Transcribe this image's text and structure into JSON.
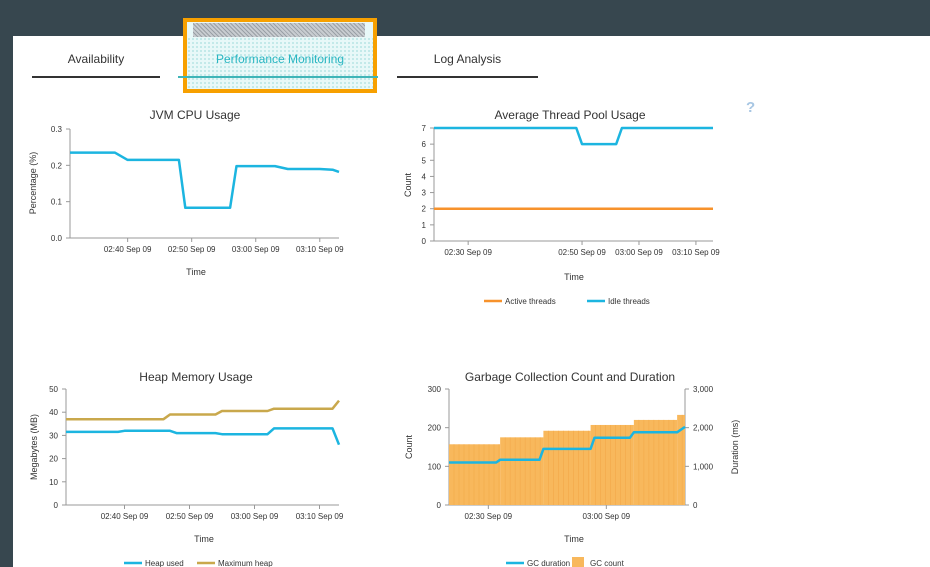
{
  "tabs": [
    {
      "label": "Availability",
      "active": false
    },
    {
      "label": "Performance Monitoring",
      "active": true
    },
    {
      "label": "Log Analysis",
      "active": false
    }
  ],
  "help": "?",
  "colors": {
    "cyan": "#1cb5e0",
    "orange": "#f7922b",
    "gold": "#c9a84c",
    "bar": "#f8b85c",
    "highlight": "#f7a000"
  },
  "chart_data": [
    {
      "type": "line",
      "title": "JVM CPU Usage",
      "xlabel": "Time",
      "ylabel": "Percentage (%)",
      "yticks": [
        "0.0",
        "0.1",
        "0.2",
        "0.3"
      ],
      "ylim": [
        0,
        0.3
      ],
      "xticks": [
        "02:40 Sep 09",
        "02:50 Sep 09",
        "03:00 Sep 09",
        "03:10 Sep 09"
      ],
      "xlim": [
        "02:31",
        "03:13"
      ],
      "series": [
        {
          "color": "#1cb5e0",
          "x": [
            "02:31",
            "02:38",
            "02:40",
            "02:48",
            "02:49",
            "02:56",
            "02:57",
            "03:03",
            "03:05",
            "03:10",
            "03:12",
            "03:13"
          ],
          "y": [
            0.235,
            0.235,
            0.215,
            0.215,
            0.083,
            0.083,
            0.198,
            0.198,
            0.19,
            0.19,
            0.188,
            0.182
          ]
        }
      ]
    },
    {
      "type": "line",
      "title": "Average Thread Pool Usage",
      "xlabel": "Time",
      "ylabel": "Count",
      "yticks": [
        "0",
        "1",
        "2",
        "3",
        "4",
        "5",
        "6",
        "7"
      ],
      "ylim": [
        0,
        7
      ],
      "xticks": [
        "02:30 Sep 09",
        "02:50 Sep 09",
        "03:00 Sep 09",
        "03:10 Sep 09"
      ],
      "xlim": [
        "02:24",
        "03:13"
      ],
      "legend": [
        {
          "name": "Active threads",
          "color": "#f7922b"
        },
        {
          "name": "Idle threads",
          "color": "#1cb5e0"
        }
      ],
      "series": [
        {
          "name": "Active threads",
          "color": "#f7922b",
          "x": [
            "02:24",
            "03:13"
          ],
          "y": [
            2,
            2
          ]
        },
        {
          "name": "Idle threads",
          "color": "#1cb5e0",
          "x": [
            "02:24",
            "02:49",
            "02:50",
            "02:56",
            "02:57",
            "03:13"
          ],
          "y": [
            7,
            7,
            6,
            6,
            7,
            7
          ]
        }
      ]
    },
    {
      "type": "line",
      "title": "Heap Memory Usage",
      "xlabel": "Time",
      "ylabel": "Megabytes (MB)",
      "yticks": [
        "0",
        "10",
        "20",
        "30",
        "40",
        "50"
      ],
      "ylim": [
        0,
        50
      ],
      "xticks": [
        "02:40 Sep 09",
        "02:50 Sep 09",
        "03:00 Sep 09",
        "03:10 Sep 09"
      ],
      "xlim": [
        "02:31",
        "03:13"
      ],
      "legend": [
        {
          "name": "Heap used",
          "color": "#1cb5e0"
        },
        {
          "name": "Maximum heap",
          "color": "#c9a84c"
        }
      ],
      "series": [
        {
          "name": "Heap used",
          "color": "#1cb5e0",
          "x": [
            "02:31",
            "02:39",
            "02:40",
            "02:47",
            "02:48",
            "02:54",
            "02:55",
            "03:02",
            "03:03",
            "03:12",
            "03:13"
          ],
          "y": [
            31.5,
            31.5,
            32,
            32,
            31,
            31,
            30.5,
            30.5,
            33,
            33,
            26
          ]
        },
        {
          "name": "Maximum heap",
          "color": "#c9a84c",
          "x": [
            "02:31",
            "02:46",
            "02:47",
            "02:54",
            "02:55",
            "03:02",
            "03:03",
            "03:12",
            "03:13"
          ],
          "y": [
            37,
            37,
            39,
            39,
            40.5,
            40.5,
            41.5,
            41.5,
            45
          ]
        }
      ]
    },
    {
      "type": "bar",
      "title": "Garbage Collection Count and Duration",
      "xlabel": "Time",
      "ylabel": "Count",
      "y2label": "Duration (ms)",
      "yticks": [
        "0",
        "100",
        "200",
        "300"
      ],
      "ylim": [
        0,
        300
      ],
      "y2ticks": [
        "0",
        "1,000",
        "2,000",
        "3,000"
      ],
      "y2lim": [
        0,
        3000
      ],
      "xticks": [
        "02:30 Sep 09",
        "03:00 Sep 09"
      ],
      "xlim": [
        "02:20",
        "03:20"
      ],
      "legend": [
        {
          "name": "GC duration",
          "color": "#1cb5e0"
        },
        {
          "name": "GC count",
          "color": "#f8b85c"
        }
      ],
      "bars": {
        "name": "GC count",
        "color": "#f8b85c",
        "x": [
          "02:20",
          "02:33",
          "02:44",
          "02:56",
          "03:07",
          "03:18"
        ],
        "x_end": "03:20",
        "y": [
          157,
          175,
          192,
          207,
          220,
          233
        ]
      },
      "line": {
        "name": "GC duration",
        "color": "#1cb5e0",
        "x": [
          "02:20",
          "02:32",
          "02:33",
          "02:43",
          "02:44",
          "02:56",
          "02:57",
          "03:06",
          "03:07",
          "03:18",
          "03:20"
        ],
        "y": [
          1100,
          1100,
          1170,
          1170,
          1450,
          1450,
          1740,
          1740,
          1880,
          1880,
          2020
        ]
      }
    }
  ]
}
